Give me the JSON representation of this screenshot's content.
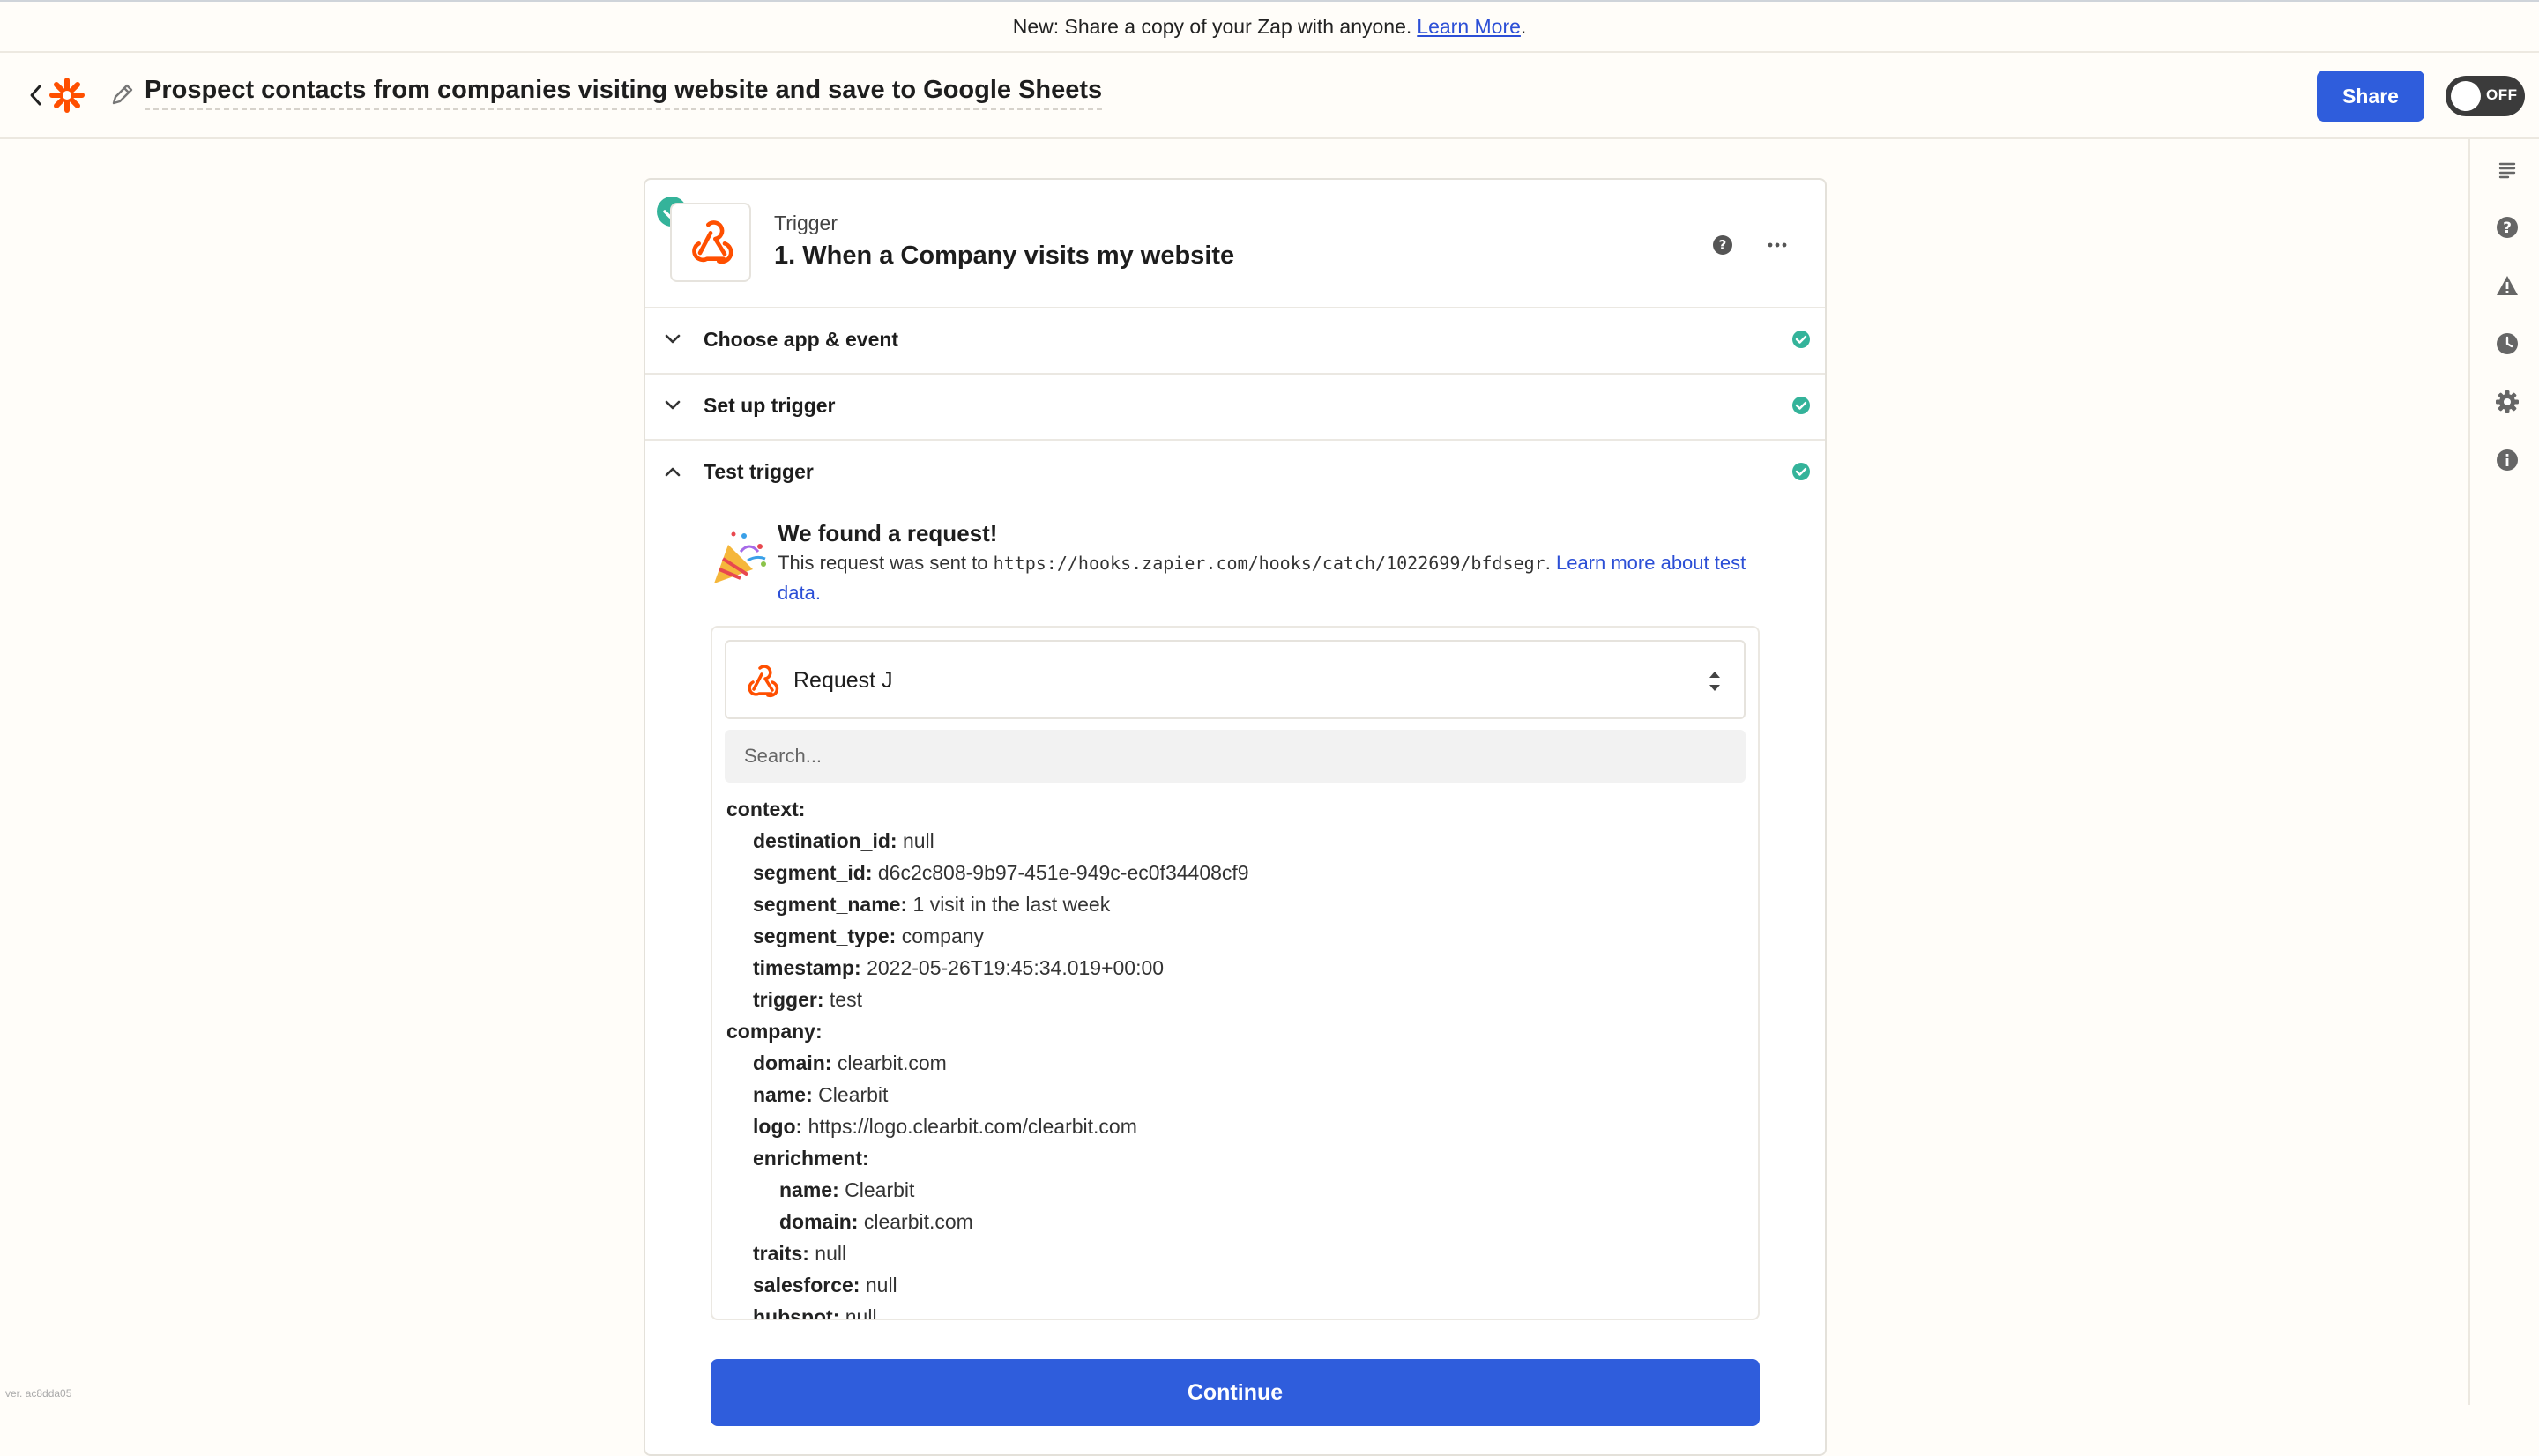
{
  "banner": {
    "text": "New: Share a copy of your Zap with anyone.",
    "link": "Learn More",
    "suffix": "."
  },
  "header": {
    "zap_title": "Prospect contacts from companies visiting website and save to Google Sheets",
    "share_label": "Share",
    "toggle_label": "OFF"
  },
  "colors": {
    "brand": "#ff4f00",
    "primary": "#2f5ddc",
    "success": "#34b39a"
  },
  "step": {
    "kind": "Trigger",
    "name": "1. When a Company visits my website",
    "sections": [
      {
        "title": "Choose app & event"
      },
      {
        "title": "Set up trigger"
      },
      {
        "title": "Test trigger"
      }
    ]
  },
  "test": {
    "found_title": "We found a request!",
    "desc_prefix": "This request was sent to",
    "url": "https://hooks.zapier.com/hooks/catch/1022699/bfdsegr",
    "desc_sep": ".",
    "learn_link": "Learn more about test data.",
    "selected_request": "Request J",
    "search_placeholder": "Search...",
    "tree": [
      {
        "depth": 0,
        "key": "context:",
        "value": ""
      },
      {
        "depth": 1,
        "key": "destination_id:",
        "value": "null"
      },
      {
        "depth": 1,
        "key": "segment_id:",
        "value": "d6c2c808-9b97-451e-949c-ec0f34408cf9"
      },
      {
        "depth": 1,
        "key": "segment_name:",
        "value": "1 visit in the last week"
      },
      {
        "depth": 1,
        "key": "segment_type:",
        "value": "company"
      },
      {
        "depth": 1,
        "key": "timestamp:",
        "value": "2022-05-26T19:45:34.019+00:00"
      },
      {
        "depth": 1,
        "key": "trigger:",
        "value": "test"
      },
      {
        "depth": 0,
        "key": "company:",
        "value": ""
      },
      {
        "depth": 1,
        "key": "domain:",
        "value": "clearbit.com"
      },
      {
        "depth": 1,
        "key": "name:",
        "value": "Clearbit"
      },
      {
        "depth": 1,
        "key": "logo:",
        "value": "https://logo.clearbit.com/clearbit.com"
      },
      {
        "depth": 1,
        "key": "enrichment:",
        "value": ""
      },
      {
        "depth": 2,
        "key": "name:",
        "value": "Clearbit"
      },
      {
        "depth": 2,
        "key": "domain:",
        "value": "clearbit.com"
      },
      {
        "depth": 1,
        "key": "traits:",
        "value": "null"
      },
      {
        "depth": 1,
        "key": "salesforce:",
        "value": "null"
      },
      {
        "depth": 1,
        "key": "hubspot:",
        "value": "null"
      }
    ],
    "continue_label": "Continue"
  },
  "rail": [
    "notes-icon",
    "help-icon",
    "warning-icon",
    "history-icon",
    "settings-icon",
    "info-icon"
  ],
  "version": "ver. ac8dda05"
}
